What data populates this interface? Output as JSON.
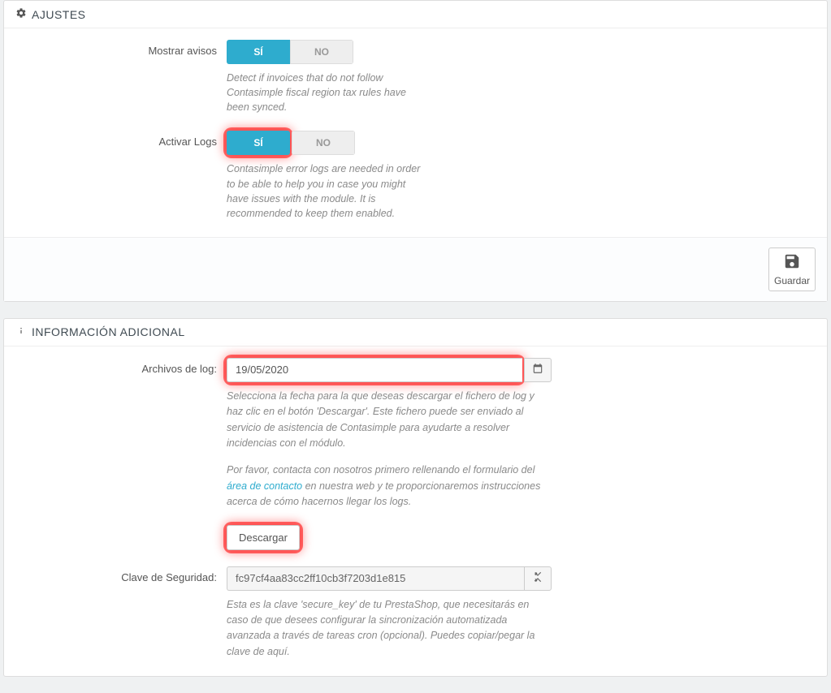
{
  "settings_panel": {
    "title": "AJUSTES",
    "show_notices": {
      "label": "Mostrar avisos",
      "yes": "SÍ",
      "no": "NO",
      "help": "Detect if invoices that do not follow Contasimple fiscal region tax rules have been synced."
    },
    "enable_logs": {
      "label": "Activar Logs",
      "yes": "SÍ",
      "no": "NO",
      "help": "Contasimple error logs are needed in order to be able to help you in case you might have issues with the module. It is recommended to keep them enabled."
    },
    "save_label": "Guardar"
  },
  "info_panel": {
    "title": "INFORMACIÓN ADICIONAL",
    "log_files": {
      "label": "Archivos de log:",
      "value": "19/05/2020",
      "help1": "Selecciona la fecha para la que deseas descargar el fichero de log y haz clic en el botón 'Descargar'. Este fichero puede ser enviado al servicio de asistencia de Contasimple para ayudarte a resolver incidencias con el módulo.",
      "help2_prefix": "Por favor, contacta con nosotros primero rellenando el formulario del ",
      "help2_link": "área de contacto",
      "help2_suffix": " en nuestra web y te proporcionaremos instrucciones acerca de cómo hacernos llegar los logs.",
      "download_label": "Descargar"
    },
    "security_key": {
      "label": "Clave de Seguridad:",
      "value": "fc97cf4aa83cc2ff10cb3f7203d1e815",
      "help": "Esta es la clave 'secure_key' de tu PrestaShop, que necesitarás en caso de que desees configurar la sincronización automatizada avanzada a través de tareas cron (opcional). Puedes copiar/pegar la clave de aquí."
    }
  }
}
